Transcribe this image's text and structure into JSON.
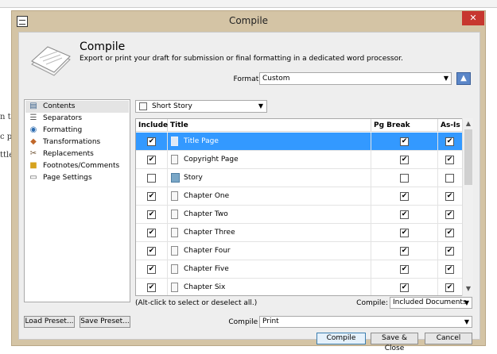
{
  "window": {
    "title": "Compile",
    "close_symbol": "✕"
  },
  "background": {
    "side_lines": [
      "n t",
      "c p",
      "ttle"
    ]
  },
  "header": {
    "title": "Compile",
    "description": "Export or print your draft for submission or final formatting in a dedicated word processor.",
    "format_label": "Format As:",
    "format_value": "Custom"
  },
  "nav": {
    "items": [
      {
        "label": "Contents",
        "icon": "contents-icon"
      },
      {
        "label": "Separators",
        "icon": "separators-icon"
      },
      {
        "label": "Formatting",
        "icon": "formatting-icon"
      },
      {
        "label": "Transformations",
        "icon": "transformations-icon"
      },
      {
        "label": "Replacements",
        "icon": "replacements-icon"
      },
      {
        "label": "Footnotes/Comments",
        "icon": "footnotes-icon"
      },
      {
        "label": "Page Settings",
        "icon": "page-settings-icon"
      }
    ]
  },
  "story_type": "Short Story",
  "table": {
    "columns": [
      "Include",
      "Title",
      "Pg Break Before",
      "As-Is"
    ],
    "rows": [
      {
        "title": "Title Page",
        "include": true,
        "pg_break": true,
        "as_is": true,
        "selected": true,
        "type": "doc"
      },
      {
        "title": "Copyright Page",
        "include": true,
        "pg_break": true,
        "as_is": true,
        "selected": false,
        "type": "doc"
      },
      {
        "title": "Story",
        "include": false,
        "pg_break": false,
        "as_is": false,
        "selected": false,
        "type": "folder"
      },
      {
        "title": "Chapter One",
        "include": true,
        "pg_break": true,
        "as_is": true,
        "selected": false,
        "type": "doc"
      },
      {
        "title": "Chapter Two",
        "include": true,
        "pg_break": true,
        "as_is": true,
        "selected": false,
        "type": "doc"
      },
      {
        "title": "Chapter Three",
        "include": true,
        "pg_break": true,
        "as_is": true,
        "selected": false,
        "type": "doc"
      },
      {
        "title": "Chapter Four",
        "include": true,
        "pg_break": true,
        "as_is": true,
        "selected": false,
        "type": "doc"
      },
      {
        "title": "Chapter Five",
        "include": true,
        "pg_break": true,
        "as_is": true,
        "selected": false,
        "type": "doc"
      },
      {
        "title": "Chapter Six",
        "include": true,
        "pg_break": true,
        "as_is": true,
        "selected": false,
        "type": "doc"
      }
    ]
  },
  "bottom": {
    "hint": "(Alt-click to select or deselect all.)",
    "compile_label": "Compile:",
    "compile_value": "Included Documents",
    "compile_for_label": "Compile For:",
    "compile_for_value": "Print",
    "load_preset": "Load Preset...",
    "save_preset": "Save Preset...",
    "compile_button": "Compile",
    "save_close_button": "Save & Close",
    "cancel_button": "Cancel"
  },
  "colors": {
    "selection": "#3399ff",
    "frame": "#d4c4a5",
    "close": "#c7372f"
  }
}
